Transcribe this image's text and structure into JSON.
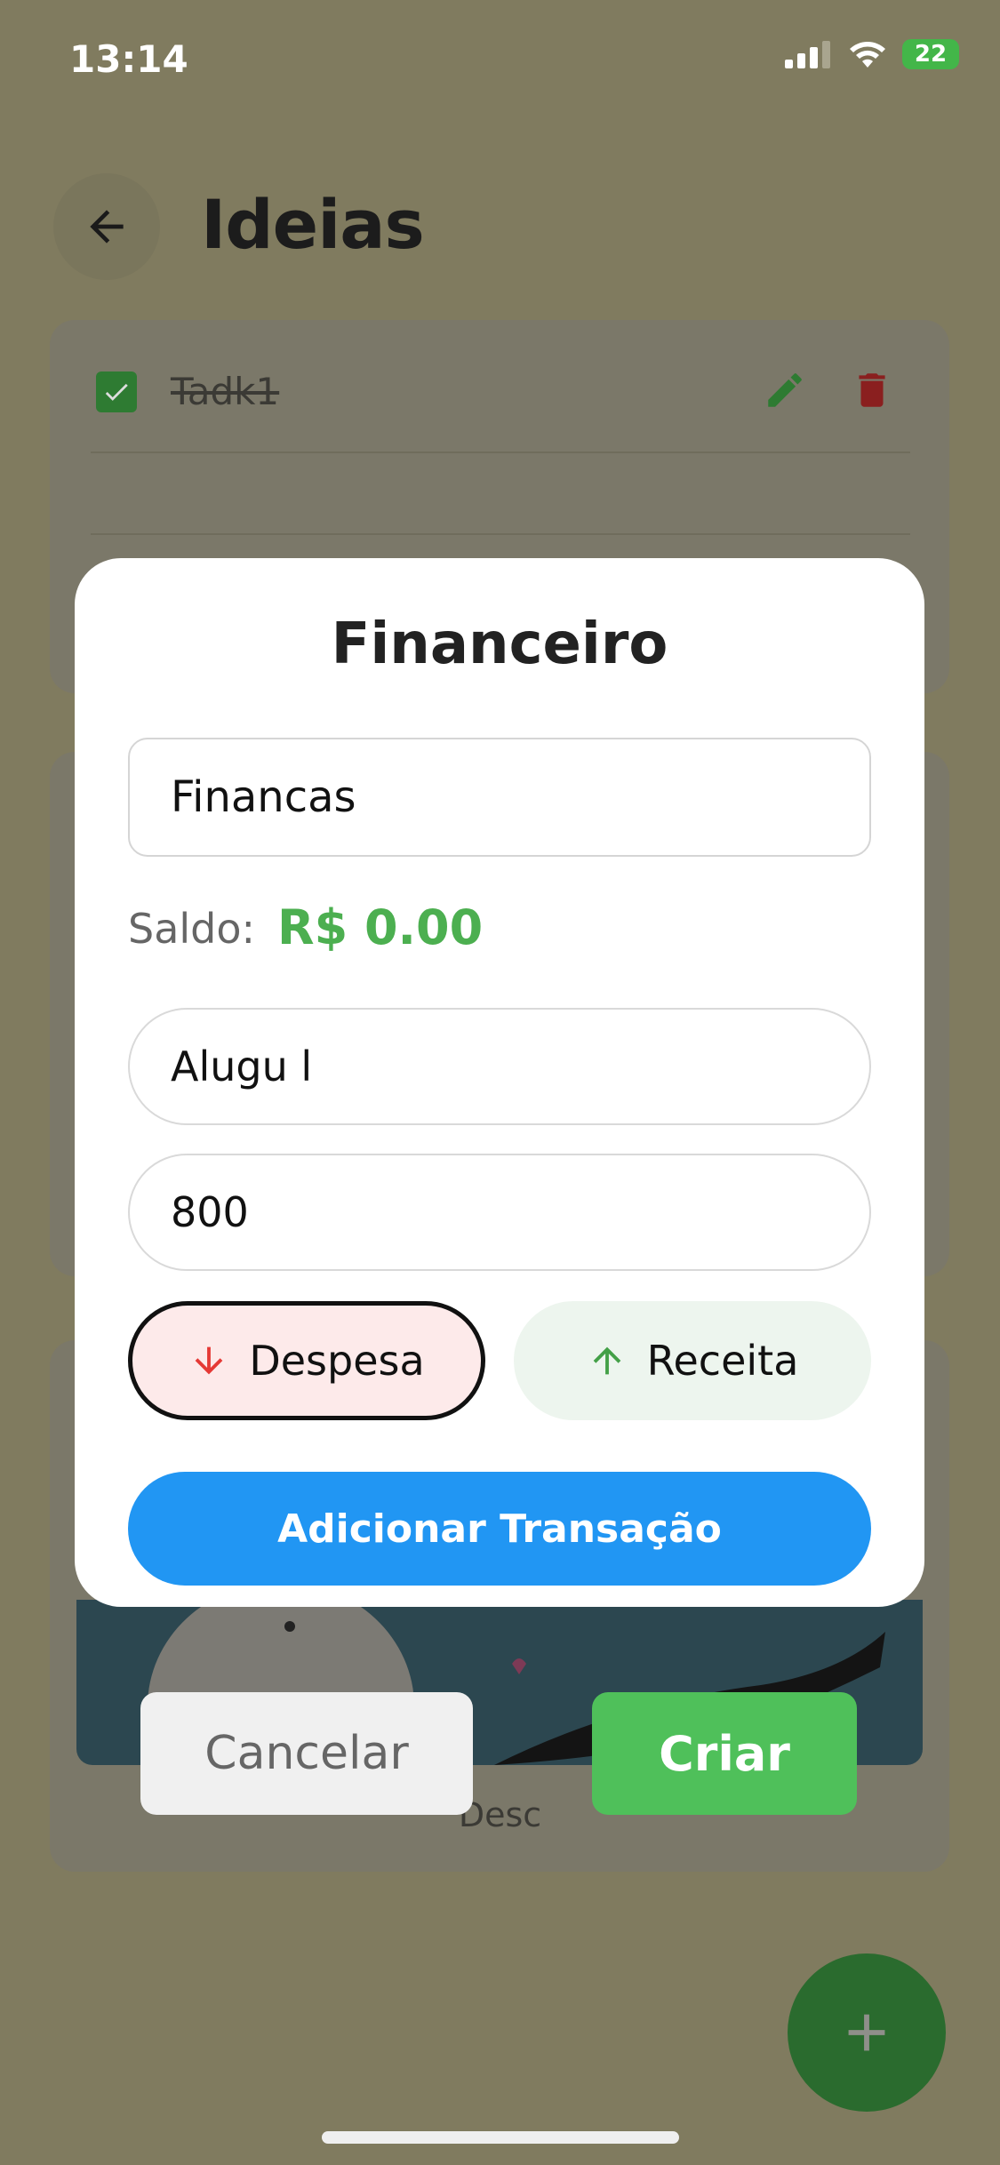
{
  "status_bar": {
    "time": "13:14",
    "battery": "22"
  },
  "header": {
    "title": "Ideias",
    "back_icon": "arrow-left-icon"
  },
  "background_cards": {
    "task": {
      "label": "Tadk1",
      "completed": true
    },
    "description": "Desc"
  },
  "modal": {
    "title": "Financeiro",
    "name_value": "Financas",
    "balance_label": "Saldo:",
    "balance_value": "R$ 0.00",
    "description_value": "Alugu l",
    "amount_value": "800",
    "expense_label": "Despesa",
    "income_label": "Receita",
    "add_button_label": "Adicionar Transação",
    "selected_type": "Despesa"
  },
  "dialog_actions": {
    "cancel_label": "Cancelar",
    "create_label": "Criar"
  },
  "colors": {
    "balance": "#4caf50",
    "primary": "#2196f3",
    "create": "#4fc05a",
    "expense_arrow": "#e53935",
    "income_arrow": "#43a047"
  }
}
